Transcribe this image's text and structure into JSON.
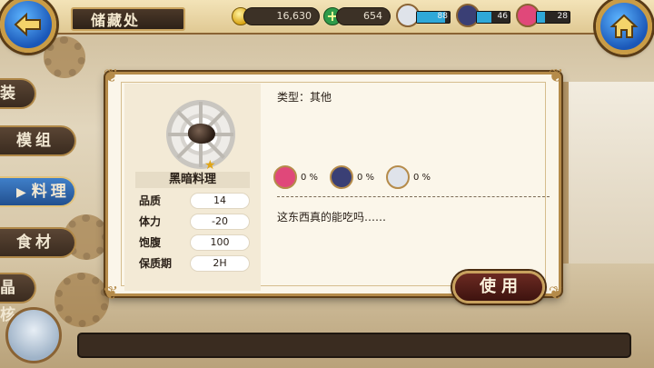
{
  "header": {
    "title": "储藏处",
    "back_icon": "back-arrow-icon",
    "home_icon": "home-icon"
  },
  "resources": {
    "gold": "16,630",
    "stamina": "654"
  },
  "party": [
    {
      "name": "white-hair-member",
      "value": "88",
      "level": 0.85,
      "color": "#dfe3ea"
    },
    {
      "name": "dark-hair-member",
      "value": "46",
      "level": 0.45,
      "color": "#3a3f75"
    },
    {
      "name": "pink-hair-member",
      "value": "28",
      "level": 0.25,
      "color": "#e0487a"
    }
  ],
  "tabs": [
    {
      "label": "装"
    },
    {
      "label": "模组"
    },
    {
      "label": "料理",
      "active": true
    },
    {
      "label": "食材"
    },
    {
      "label": "晶核"
    }
  ],
  "dialog": {
    "item": {
      "name": "黑暗料理",
      "stats": [
        {
          "label": "品质",
          "value": "14"
        },
        {
          "label": "体力",
          "value": "-20"
        },
        {
          "label": "饱腹",
          "value": "100"
        },
        {
          "label": "保质期",
          "value": "2H"
        }
      ]
    },
    "type_line": "类型：其他",
    "affinity": [
      {
        "character": "pink-hair",
        "pct": "0 %",
        "color": "#e0487a"
      },
      {
        "character": "dark-hair",
        "pct": "0 %",
        "color": "#3a3f75"
      },
      {
        "character": "white-hair",
        "pct": "0 %",
        "color": "#dfe3ea"
      }
    ],
    "description": "这东西真的能吃吗……",
    "use_label": "使用"
  },
  "colors": {
    "accent_gold": "#c99c46",
    "panel_bg": "#fbf6ea",
    "use_button": "#6b2a22",
    "active_tab": "#3f7fc9"
  }
}
